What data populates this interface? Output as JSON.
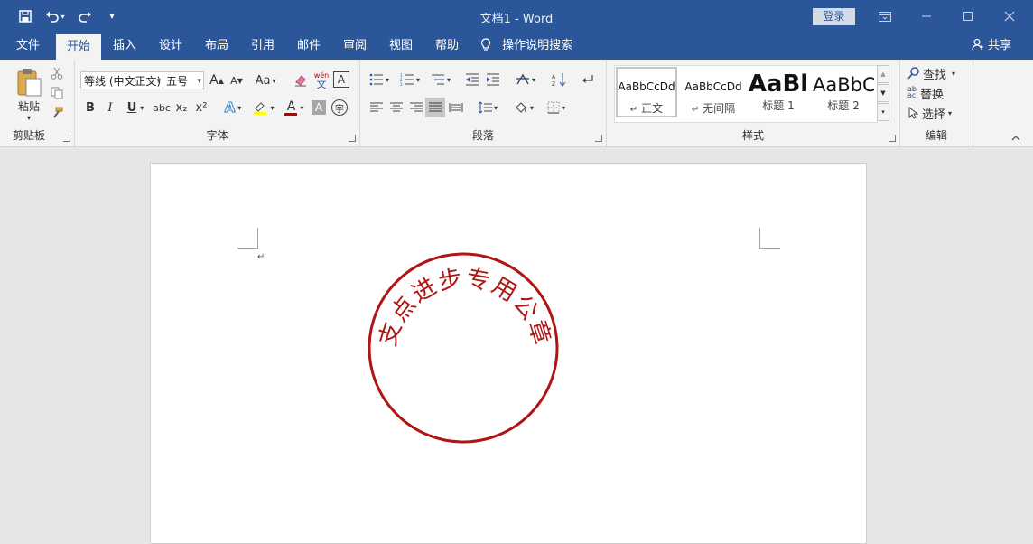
{
  "titlebar": {
    "title": "文档1  -  Word",
    "login_label": "登录",
    "qat_customize_glyph": "▾"
  },
  "tabs": [
    "文件",
    "开始",
    "插入",
    "设计",
    "布局",
    "引用",
    "邮件",
    "审阅",
    "视图",
    "帮助"
  ],
  "tell_me": {
    "label": "操作说明搜索"
  },
  "share": {
    "label": "共享"
  },
  "clipboard": {
    "paste_label": "粘贴",
    "group_label": "剪贴板"
  },
  "font": {
    "name_value": "等线 (中文正文)",
    "size_value": "五号",
    "change_case_label": "Aa",
    "group_label": "字体",
    "bold": "B",
    "italic": "I",
    "underline": "U",
    "strike": "abc",
    "subscript": "x₂",
    "superscript": "x²",
    "phonetic_top": "wén",
    "phonetic_bottom": "文",
    "font_color_glyph": "A",
    "shade_glyph": "A",
    "enclose_glyph": "字",
    "border_glyph": "A",
    "effects_glyph": "A",
    "grow_glyph": "A",
    "shrink_glyph": "A"
  },
  "paragraph": {
    "group_label": "段落"
  },
  "styles": {
    "group_label": "样式",
    "items": [
      {
        "sample": "AaBbCcDd",
        "name": "正文",
        "marker": "↵"
      },
      {
        "sample": "AaBbCcDd",
        "name": "无间隔",
        "marker": "↵"
      },
      {
        "sample": "AaBl",
        "name": "标题 1",
        "marker": ""
      },
      {
        "sample": "AaBbC",
        "name": "标题 2",
        "marker": ""
      }
    ]
  },
  "editing": {
    "group_label": "编辑",
    "find_label": "查找",
    "replace_label": "替换",
    "select_label": "选择",
    "replace_icon_top": "ab",
    "replace_icon_bottom": "ac"
  },
  "document": {
    "paragraph_mark": "↵",
    "seal": {
      "text": "支点进步专用公章",
      "color": "#b01414"
    }
  },
  "colors": {
    "brand": "#2b579a",
    "ribbon_bg": "#f3f3f3",
    "workspace_bg": "#e6e6e6",
    "highlight_yellow": "#ffff00",
    "font_red": "#c00000"
  }
}
